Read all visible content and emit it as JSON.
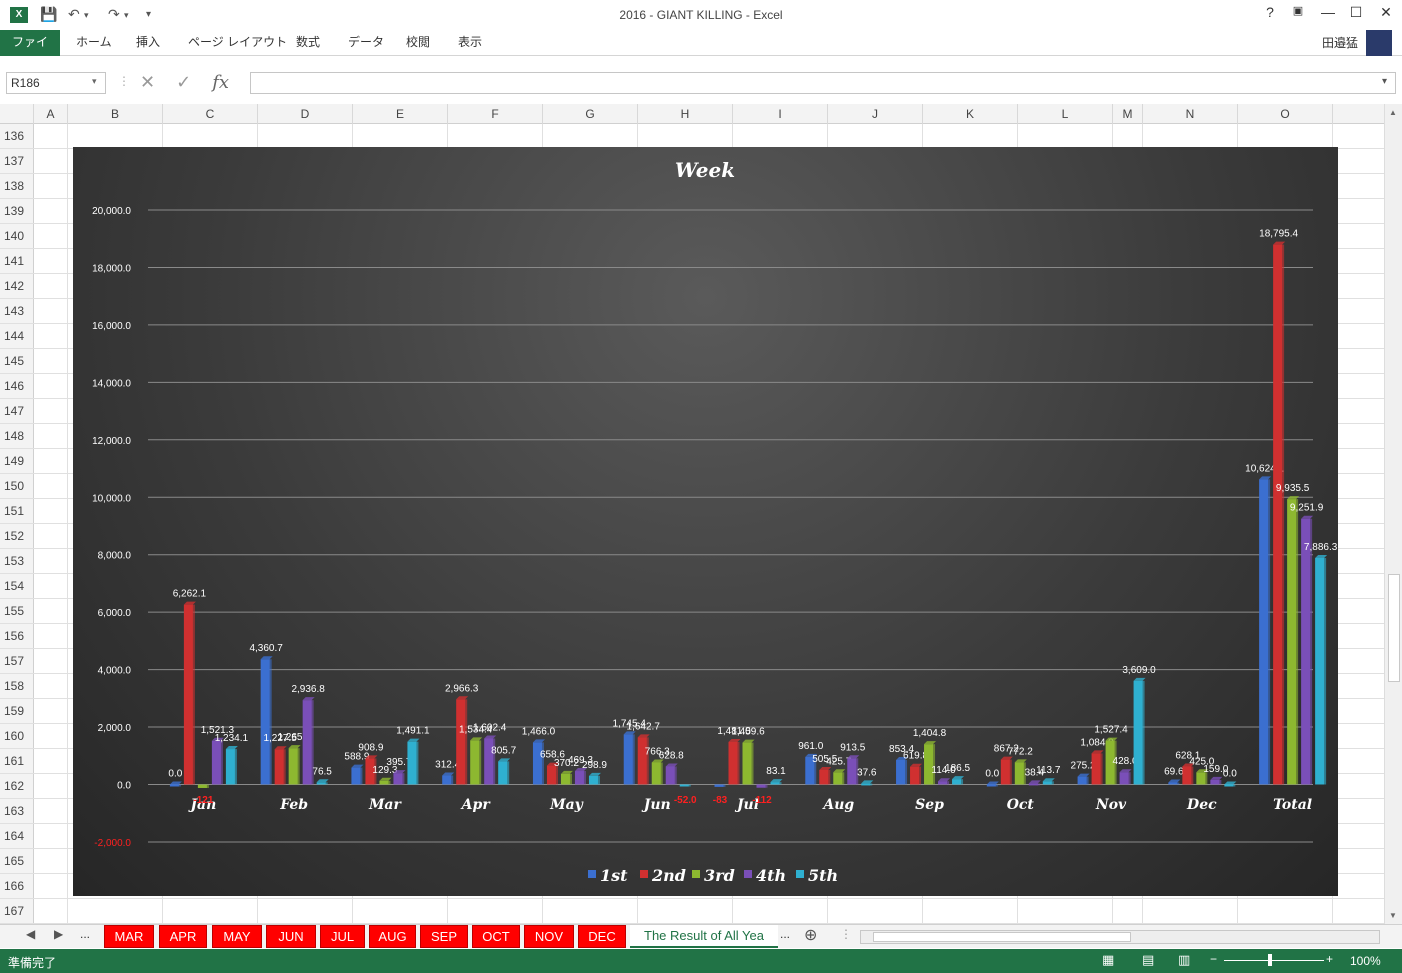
{
  "window": {
    "title": "2016 - GIANT KILLING - Excel"
  },
  "quick_access": {
    "save_icon": "save-icon",
    "undo_icon": "undo-icon",
    "redo_icon": "redo-icon",
    "customize_icon": "customize-icon"
  },
  "window_buttons": {
    "help": "?",
    "restore_ribbon": "▣",
    "minimize": "—",
    "maximize": "☐",
    "close": "✕"
  },
  "ribbon": {
    "file": "ファイル",
    "tabs": [
      "ホーム",
      "挿入",
      "ページ レイアウト",
      "数式",
      "データ",
      "校閲",
      "表示"
    ],
    "user": "田邉猛"
  },
  "formula_bar": {
    "name_box": "R186",
    "formula": ""
  },
  "columns": [
    "A",
    "B",
    "C",
    "D",
    "E",
    "F",
    "G",
    "H",
    "I",
    "J",
    "K",
    "L",
    "M",
    "N",
    "O"
  ],
  "rows": [
    "136",
    "137",
    "138",
    "139",
    "140",
    "141",
    "142",
    "143",
    "144",
    "145",
    "146",
    "147",
    "148",
    "149",
    "150",
    "151",
    "152",
    "153",
    "154",
    "155",
    "156",
    "157",
    "158",
    "159",
    "160",
    "161",
    "162",
    "163",
    "164",
    "165",
    "166",
    "167"
  ],
  "sheet_tabs": {
    "more_left": "...",
    "tabs": [
      "MAR",
      "APR",
      "MAY",
      "JUN",
      "JUL",
      "AUG",
      "SEP",
      "OCT",
      "NOV",
      "DEC"
    ],
    "active": "The Result of All Yea",
    "more_right": "...",
    "add": "⊕"
  },
  "status": {
    "ready": "準備完了",
    "zoom": "100%"
  },
  "chart_data": {
    "type": "bar",
    "title": "Week",
    "categories": [
      "Jan",
      "Feb",
      "Mar",
      "Apr",
      "May",
      "Jun",
      "Jul",
      "Aug",
      "Sep",
      "Oct",
      "Nov",
      "Dec",
      "Total"
    ],
    "ylim": [
      -2000,
      20000
    ],
    "yticks": [
      "-2,000.0",
      "0.0",
      "2,000.0",
      "4,000.0",
      "6,000.0",
      "8,000.0",
      "10,000.0",
      "12,000.0",
      "14,000.0",
      "16,000.0",
      "18,000.0",
      "20,000.0"
    ],
    "grid": true,
    "legend": "bottom",
    "series": [
      {
        "name": "1st",
        "color": "#3b6fd0",
        "values": [
          0.0,
          4360.7,
          588.9,
          312.4,
          1466.0,
          1745.4,
          -83.0,
          961.0,
          853.4,
          0.0,
          275.2,
          69.6,
          10624.1
        ],
        "labels": [
          "0.0",
          "4,360.7",
          "588.9",
          "312.4",
          "1,466.0",
          "1,745.4",
          "",
          "961.0",
          "853.4",
          "0.0",
          "275.2",
          "69.6",
          "10,624.1"
        ]
      },
      {
        "name": "2nd",
        "color": "#d03030",
        "values": [
          6262.1,
          1227.5,
          908.9,
          2966.3,
          658.6,
          1642.7,
          1481.0,
          505.5,
          619.8,
          867.2,
          1084.0,
          628.1,
          18795.4
        ],
        "labels": [
          "6,262.1",
          "1,227.5",
          "908.9",
          "2,966.3",
          "658.6",
          "1,642.7",
          "1,481.0",
          "505.5",
          "619.8",
          "867.2",
          "1,084.0",
          "628.1",
          "18,795.4"
        ]
      },
      {
        "name": "3rd",
        "color": "#8db830",
        "values": [
          -121.0,
          1265.2,
          129.3,
          1534.4,
          370.2,
          766.3,
          1459.6,
          425.7,
          1404.8,
          772.2,
          1527.4,
          425.0,
          9935.5
        ],
        "labels": [
          "",
          "1,265.2",
          "129.3",
          "1,534.4",
          "370.2",
          "766.3",
          "1,459.6",
          "425.7",
          "1,404.8",
          "772.2",
          "1,527.4",
          "425.0",
          "9,935.5"
        ]
      },
      {
        "name": "4th",
        "color": "#7a4fb8",
        "values": [
          1521.3,
          2936.8,
          395.7,
          1602.4,
          469.3,
          628.8,
          -112.0,
          913.5,
          114.0,
          38.4,
          428.0,
          159.0,
          9251.9
        ],
        "labels": [
          "1,521.3",
          "2,936.8",
          "395.7",
          "1,602.4",
          "469.3",
          "628.8",
          "",
          "913.5",
          "114.0",
          "38.4",
          "428.0",
          "159.0",
          "9,251.9"
        ]
      },
      {
        "name": "5th",
        "color": "#2fb0d0",
        "values": [
          1234.1,
          76.5,
          1491.1,
          805.7,
          298.9,
          -52.0,
          83.1,
          37.6,
          186.5,
          113.7,
          3609.0,
          0.0,
          7886.3
        ],
        "labels": [
          "1,234.1",
          "76.5",
          "1,491.1",
          "805.7",
          "298.9",
          "",
          "83.1",
          "37.6",
          "186.5",
          "113.7",
          "3,609.0",
          "0.0",
          "7,886.3"
        ]
      }
    ],
    "negative_labels": [
      {
        "category": "Jan",
        "series": "3rd",
        "text": "-121"
      },
      {
        "category": "Jun",
        "series": "5th",
        "text": "-52.0"
      },
      {
        "category": "Jul",
        "series": "1st",
        "text": "-83"
      },
      {
        "category": "Jul",
        "series": "4th",
        "text": "-112"
      }
    ]
  }
}
